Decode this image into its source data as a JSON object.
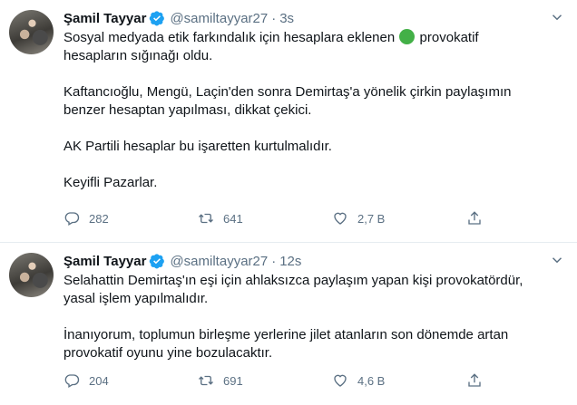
{
  "tweets": [
    {
      "author_name": "Şamil Tayyar",
      "handle": "@samiltayyar27",
      "separator": "·",
      "time": "3s",
      "paragraphs": [
        {
          "before": "Sosyal medyada etik farkındalık için hesaplara eklenen ",
          "after": " provokatif\nhesapların sığınağı oldu."
        },
        {
          "text": "Kaftancıoğlu, Mengü, Laçin'den sonra Demirtaş'a yönelik çirkin paylaşımın\nbenzer hesaptan yapılması, dikkat çekici."
        },
        {
          "text": "AK Partili hesaplar bu işaretten kurtulmalıdır."
        },
        {
          "text": "Keyifli Pazarlar."
        }
      ],
      "replies": "282",
      "retweets": "641",
      "likes": "2,7 B"
    },
    {
      "author_name": "Şamil Tayyar",
      "handle": "@samiltayyar27",
      "separator": "·",
      "time": "12s",
      "paragraphs": [
        {
          "text": "Selahattin Demirtaş'ın eşi için ahlaksızca paylaşım yapan kişi provokatördür,\nyasal işlem yapılmalıdır."
        },
        {
          "text": "İnanıyorum, toplumun birleşme yerlerine jilet atanların son dönemde artan\nprovokatif oyunu yine bozulacaktır."
        }
      ],
      "replies": "204",
      "retweets": "691",
      "likes": "4,6 B"
    }
  ],
  "icons": {
    "verified": "verified-badge-icon",
    "more": "chevron-down-icon",
    "reply": "reply-icon",
    "retweet": "retweet-icon",
    "like": "heart-icon",
    "share": "share-icon"
  },
  "colors": {
    "accent": "#1da1f2",
    "secondary_text": "#5b7083",
    "emoji_green": "#43b047",
    "divider": "#e6ecf0"
  }
}
